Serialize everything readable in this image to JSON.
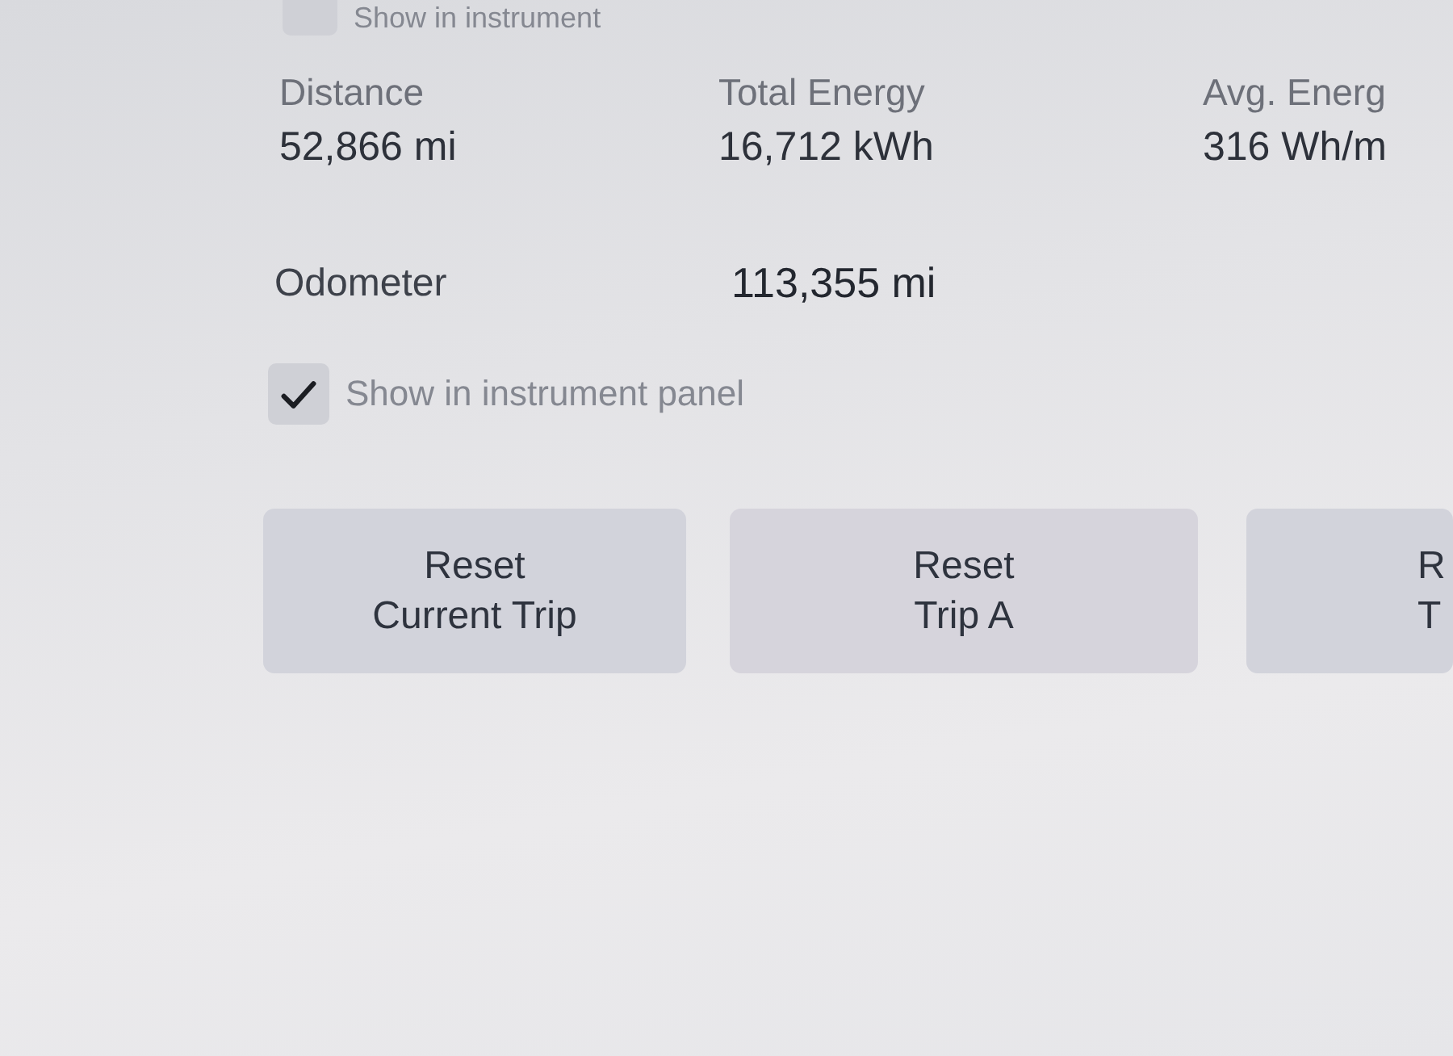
{
  "top_option": {
    "label": "Show in instrument",
    "checked": false
  },
  "stats": [
    {
      "label": "Distance",
      "value": "52,866 mi"
    },
    {
      "label": "Total Energy",
      "value": "16,712 kWh"
    },
    {
      "label": "Avg. Energ",
      "value": "316 Wh/m"
    }
  ],
  "odometer": {
    "label": "Odometer",
    "value": "113,355 mi"
  },
  "instrument_panel_option": {
    "label": "Show in instrument panel",
    "checked": true
  },
  "buttons": [
    {
      "lines": [
        "Reset",
        "Current Trip"
      ]
    },
    {
      "lines": [
        "Reset",
        "Trip A"
      ]
    },
    {
      "lines": [
        "R",
        "T"
      ]
    }
  ]
}
